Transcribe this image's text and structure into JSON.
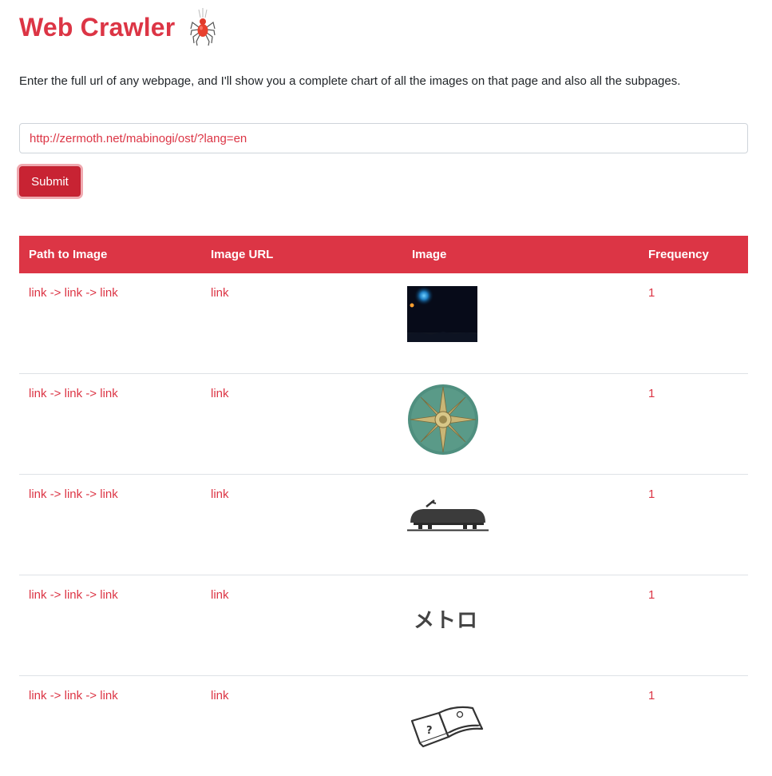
{
  "header": {
    "title": "Web Crawler",
    "logo_icon": "spider-icon"
  },
  "intro_text": "Enter the full url of any webpage, and I'll show you a complete chart of all the images on that page and also all the subpages.",
  "form": {
    "url_value": "http://zermoth.net/mabinogi/ost/?lang=en",
    "submit_label": "Submit"
  },
  "table": {
    "columns": [
      "Path to Image",
      "Image URL",
      "Image",
      "Frequency"
    ],
    "rows": [
      {
        "path": [
          "link",
          "link",
          "link"
        ],
        "separator": "->",
        "image_url": "link",
        "image": "night-sky-thumbnail",
        "frequency": "1"
      },
      {
        "path": [
          "link",
          "link",
          "link"
        ],
        "separator": "->",
        "image_url": "link",
        "image": "compass-rose-medallion",
        "frequency": "1"
      },
      {
        "path": [
          "link",
          "link",
          "link"
        ],
        "separator": "->",
        "image_url": "link",
        "image": "tram-silhouette-icon",
        "frequency": "1"
      },
      {
        "path": [
          "link",
          "link",
          "link"
        ],
        "separator": "->",
        "image_url": "link",
        "image": "metro-katakana-text",
        "image_text": "メトロ",
        "frequency": "1"
      },
      {
        "path": [
          "link",
          "link",
          "link"
        ],
        "separator": "->",
        "image_url": "link",
        "image": "open-book-icon",
        "frequency": "1"
      }
    ]
  },
  "colors": {
    "accent": "#dc3545",
    "button": "#c82333",
    "text": "#212529"
  }
}
